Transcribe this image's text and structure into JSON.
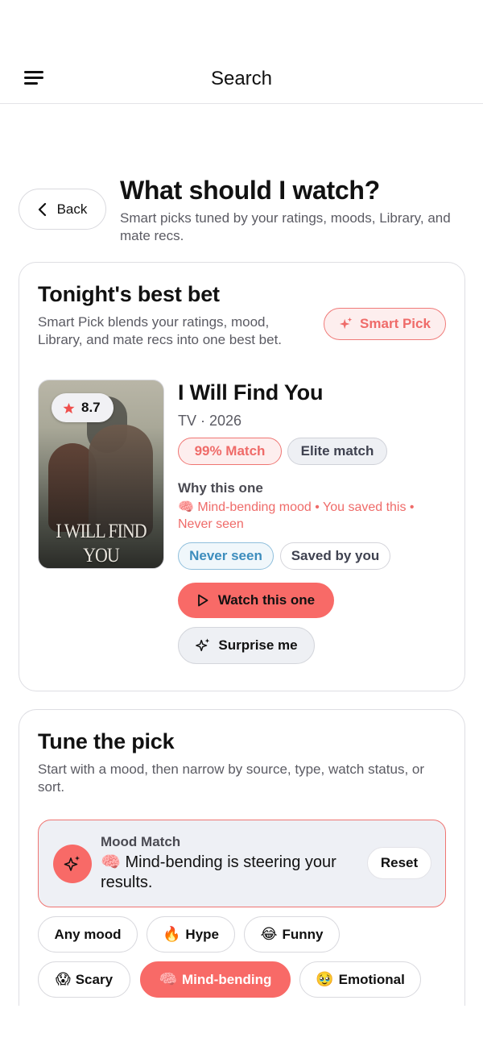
{
  "nav": {
    "title": "Search",
    "menu_icon": "hamburger-menu-icon"
  },
  "header": {
    "back_label": "Back",
    "title": "What should I watch?",
    "subtitle": "Smart picks tuned by your ratings, moods, Library, and mate recs."
  },
  "best_bet": {
    "title": "Tonight's best bet",
    "description": "Smart Pick blends your ratings, mood, Library, and mate recs into one best bet.",
    "smart_pick_label": "Smart Pick",
    "poster_text": "I WILL FIND YOU",
    "rating": "8.7",
    "show_title": "I Will Find You",
    "show_meta": "TV · 2026",
    "match_badge": "99% Match",
    "elite_badge": "Elite match",
    "why_label": "Why this one",
    "why_text": "🧠 Mind-bending mood • You saved this • Never seen",
    "never_seen_badge": "Never seen",
    "saved_badge": "Saved by you",
    "watch_label": "Watch this one",
    "surprise_label": "Surprise me",
    "colors": {
      "accent": "#f86a67",
      "accent_text": "#ef6b69",
      "info": "#3d8dbd"
    }
  },
  "tune": {
    "title": "Tune the pick",
    "description": "Start with a mood, then narrow by source, type, watch status, or sort.",
    "mood_match_label": "Mood Match",
    "mood_match_text": "🧠 Mind-bending is steering your results.",
    "reset_label": "Reset",
    "chips": [
      {
        "emoji": "",
        "label": "Any mood",
        "active": false
      },
      {
        "emoji": "🔥",
        "label": "Hype",
        "active": false
      },
      {
        "emoji": "😂",
        "label": "Funny",
        "active": false
      },
      {
        "emoji": "😱",
        "label": "Scary",
        "active": false
      },
      {
        "emoji": "🧠",
        "label": "Mind-bending",
        "active": true
      },
      {
        "emoji": "🥹",
        "label": "Emotional",
        "active": false
      }
    ]
  }
}
